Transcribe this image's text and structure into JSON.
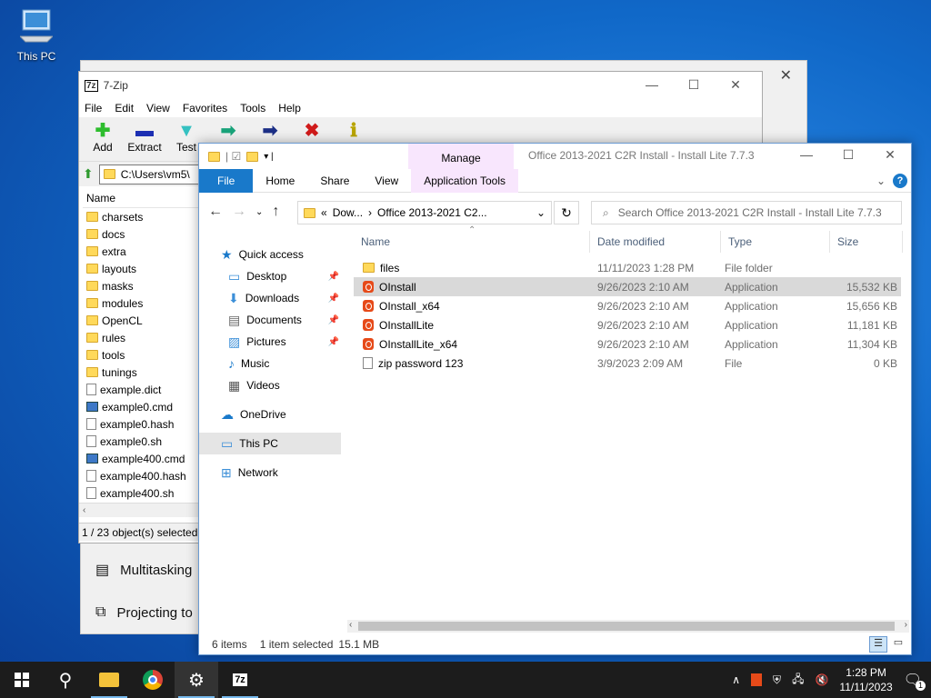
{
  "desktop": {
    "icon_label": "This PC"
  },
  "settings": {
    "items": [
      "Multitasking",
      "Projecting to"
    ]
  },
  "sevenzip": {
    "title": "7-Zip",
    "menu": [
      "File",
      "Edit",
      "View",
      "Favorites",
      "Tools",
      "Help"
    ],
    "tools": [
      {
        "label": "Add",
        "icon": "plus-icon",
        "color": "#2dbd2d"
      },
      {
        "label": "Extract",
        "icon": "minus-icon",
        "color": "#1c2fb3"
      },
      {
        "label": "Test",
        "icon": "check-icon",
        "color": "#35c1c1"
      },
      {
        "label": "",
        "icon": "copy-arrow-icon",
        "color": "#19a37a"
      },
      {
        "label": "",
        "icon": "move-arrow-icon",
        "color": "#1c2f86"
      },
      {
        "label": "",
        "icon": "delete-icon",
        "color": "#d01b1b"
      },
      {
        "label": "",
        "icon": "info-icon",
        "color": "#b8a400"
      }
    ],
    "address": "C:\\Users\\vm5\\",
    "column_name": "Name",
    "items": [
      {
        "name": "charsets",
        "type": "folder"
      },
      {
        "name": "docs",
        "type": "folder"
      },
      {
        "name": "extra",
        "type": "folder"
      },
      {
        "name": "layouts",
        "type": "folder"
      },
      {
        "name": "masks",
        "type": "folder"
      },
      {
        "name": "modules",
        "type": "folder"
      },
      {
        "name": "OpenCL",
        "type": "folder"
      },
      {
        "name": "rules",
        "type": "folder"
      },
      {
        "name": "tools",
        "type": "folder"
      },
      {
        "name": "tunings",
        "type": "folder"
      },
      {
        "name": "example.dict",
        "type": "file"
      },
      {
        "name": "example0.cmd",
        "type": "cmd"
      },
      {
        "name": "example0.hash",
        "type": "file"
      },
      {
        "name": "example0.sh",
        "type": "file"
      },
      {
        "name": "example400.cmd",
        "type": "cmd"
      },
      {
        "name": "example400.hash",
        "type": "file"
      },
      {
        "name": "example400.sh",
        "type": "file"
      }
    ],
    "status": "1 / 23 object(s) selected"
  },
  "explorer": {
    "title": "Office 2013-2021 C2R Install - Install Lite 7.7.3",
    "manage_label": "Manage",
    "ribbon_tabs": [
      "File",
      "Home",
      "Share",
      "View",
      "Application Tools"
    ],
    "path_parts": [
      "«",
      "Dow...",
      "›",
      "Office 2013-2021 C2..."
    ],
    "search_placeholder": "Search Office 2013-2021 C2R Install - Install Lite 7.7.3",
    "nav": [
      {
        "label": "Quick access",
        "icon": "star-icon",
        "pinned": false
      },
      {
        "label": "Desktop",
        "icon": "desktop-icon",
        "pinned": true
      },
      {
        "label": "Downloads",
        "icon": "download-icon",
        "pinned": true
      },
      {
        "label": "Documents",
        "icon": "documents-icon",
        "pinned": true
      },
      {
        "label": "Pictures",
        "icon": "pictures-icon",
        "pinned": true
      },
      {
        "label": "Music",
        "icon": "music-icon",
        "pinned": false
      },
      {
        "label": "Videos",
        "icon": "videos-icon",
        "pinned": false
      },
      {
        "label": "OneDrive",
        "icon": "cloud-icon",
        "pinned": false
      },
      {
        "label": "This PC",
        "icon": "pc-icon",
        "pinned": false
      },
      {
        "label": "Network",
        "icon": "network-icon",
        "pinned": false
      }
    ],
    "columns": [
      "Name",
      "Date modified",
      "Type",
      "Size"
    ],
    "files": [
      {
        "name": "files",
        "date": "11/11/2023 1:28 PM",
        "type": "File folder",
        "size": "",
        "kind": "folder"
      },
      {
        "name": "OInstall",
        "date": "9/26/2023 2:10 AM",
        "type": "Application",
        "size": "15,532 KB",
        "kind": "app"
      },
      {
        "name": "OInstall_x64",
        "date": "9/26/2023 2:10 AM",
        "type": "Application",
        "size": "15,656 KB",
        "kind": "app"
      },
      {
        "name": "OInstallLite",
        "date": "9/26/2023 2:10 AM",
        "type": "Application",
        "size": "11,181 KB",
        "kind": "app"
      },
      {
        "name": "OInstallLite_x64",
        "date": "9/26/2023 2:10 AM",
        "type": "Application",
        "size": "11,304 KB",
        "kind": "app"
      },
      {
        "name": "zip password 123",
        "date": "3/9/2023 2:09 AM",
        "type": "File",
        "size": "0 KB",
        "kind": "file"
      }
    ],
    "status": {
      "count": "6 items",
      "selected": "1 item selected",
      "size": "15.1 MB"
    }
  },
  "taskbar": {
    "time": "1:28 PM",
    "date": "11/11/2023",
    "notification_count": "1"
  }
}
